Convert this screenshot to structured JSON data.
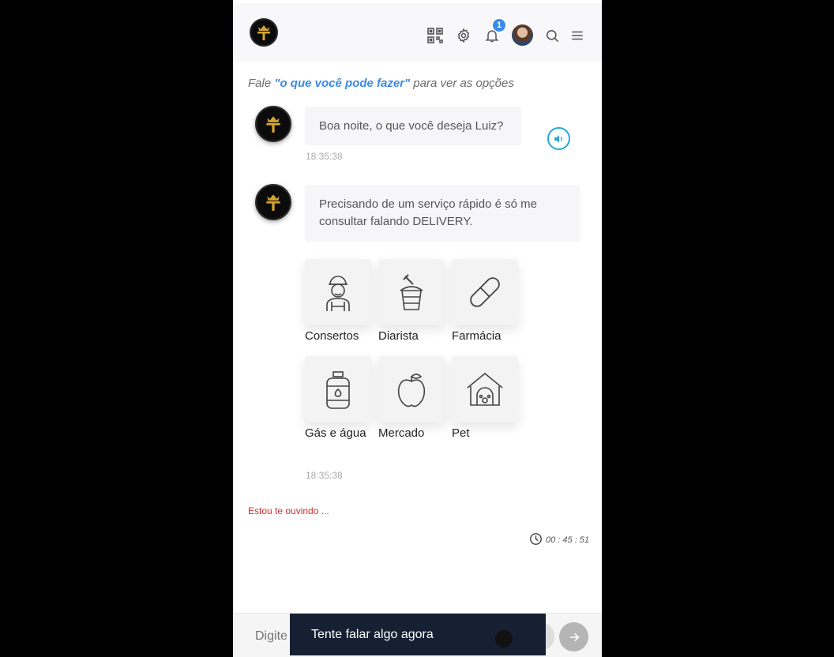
{
  "header": {
    "icons": [
      "qr-code-icon",
      "gear-icon",
      "bell-icon",
      "search-icon",
      "menu-icon"
    ],
    "notification_count": "1"
  },
  "hint": {
    "prefix": "Fale ",
    "command": "\"o que você pode fazer\"",
    "suffix": " para ver as opções"
  },
  "messages": [
    {
      "text": "Boa noite, o que você deseja Luiz?",
      "time": "18:35:38"
    },
    {
      "text": "Precisando de um serviço rápido é só me consultar falando DELIVERY.",
      "time": "18:35:38"
    }
  ],
  "services": [
    {
      "label": "Consertos",
      "icon": "repairman-icon"
    },
    {
      "label": "Diarista",
      "icon": "cleaning-bucket-icon"
    },
    {
      "label": "Farmácia",
      "icon": "pill-icon"
    },
    {
      "label": "Gás e água",
      "icon": "gas-cylinder-icon"
    },
    {
      "label": "Mercado",
      "icon": "apple-icon"
    },
    {
      "label": "Pet",
      "icon": "dog-house-icon"
    }
  ],
  "status": {
    "listening": "Estou te ouvindo ...",
    "timer": "00 : 45 : 51"
  },
  "composer": {
    "placeholder": "Digite"
  },
  "toast": {
    "text": "Tente falar algo agora"
  },
  "colors": {
    "accent": "#3b8ae6",
    "listening": "#d32f2f",
    "speaker": "#29a8d8",
    "toast_bg": "#172033"
  }
}
